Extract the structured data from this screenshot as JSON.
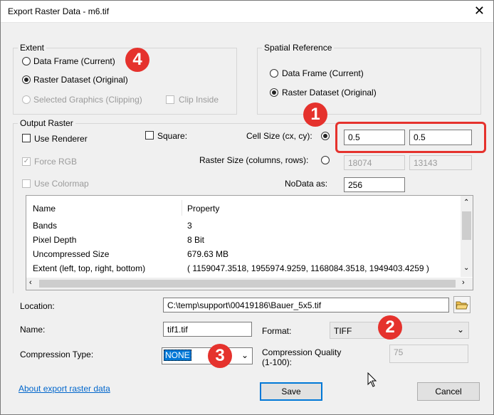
{
  "window": {
    "title": "Export Raster Data - m6.tif",
    "close": "✕"
  },
  "extent": {
    "label": "Extent",
    "options": [
      "Data Frame (Current)",
      "Raster Dataset (Original)",
      "Selected Graphics (Clipping)"
    ],
    "selected_index": 1,
    "clip_inside": "Clip Inside"
  },
  "spatial_reference": {
    "label": "Spatial Reference",
    "options": [
      "Data Frame (Current)",
      "Raster Dataset (Original)"
    ],
    "selected_index": 1
  },
  "output_raster": {
    "label": "Output Raster",
    "use_renderer": "Use Renderer",
    "force_rgb": "Force RGB",
    "use_colormap": "Use Colormap",
    "square": "Square:",
    "cell_size_label": "Cell Size (cx, cy):",
    "cell_cx": "0.5",
    "cell_cy": "0.5",
    "raster_size_label": "Raster Size (columns, rows):",
    "columns": "18074",
    "rows": "13143",
    "nodata_label": "NoData as:",
    "nodata_value": "256"
  },
  "properties": {
    "headers": [
      "Name",
      "Property"
    ],
    "rows": [
      [
        "Bands",
        "3"
      ],
      [
        "Pixel Depth",
        "8 Bit"
      ],
      [
        "Uncompressed Size",
        "679.63 MB"
      ],
      [
        "Extent (left, top, right, bottom)",
        "( 1159047.3518, 1955974.9259, 1168084.3518, 1949403.4259 )"
      ]
    ]
  },
  "location": {
    "label": "Location:",
    "value": "C:\\temp\\support\\00419186\\Bauer_5x5.tif"
  },
  "name": {
    "label": "Name:",
    "value": "tif1.tif"
  },
  "format": {
    "label": "Format:",
    "value": "TIFF"
  },
  "compression": {
    "label": "Compression Type:",
    "value": "NONE"
  },
  "quality": {
    "label_line1": "Compression Quality",
    "label_line2": "(1-100):",
    "value": "75"
  },
  "footer": {
    "about": "About export raster data",
    "save": "Save",
    "cancel": "Cancel"
  },
  "annotations": {
    "b1": "1",
    "b2": "2",
    "b3": "3",
    "b4": "4",
    "accent": "#e5322d"
  }
}
